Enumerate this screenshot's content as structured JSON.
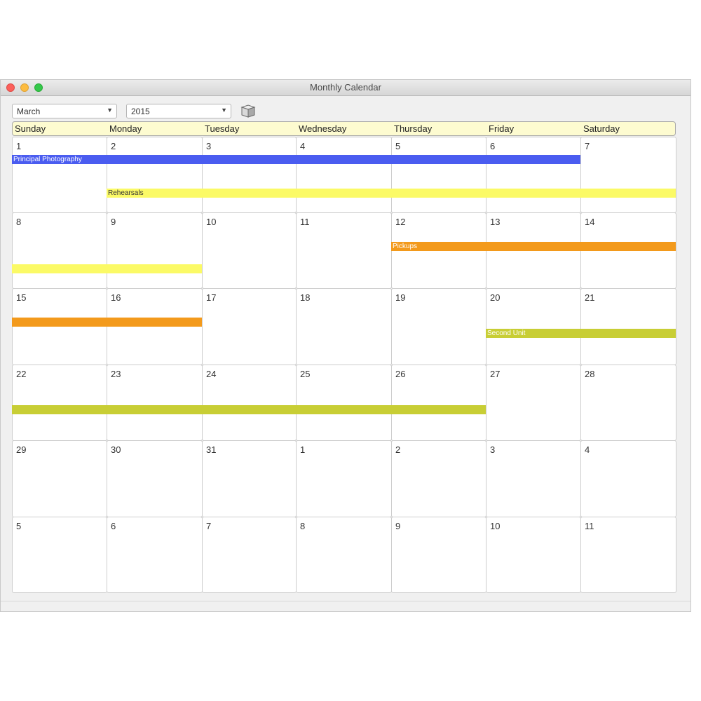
{
  "window": {
    "title": "Monthly Calendar"
  },
  "controls": {
    "month": "March",
    "year": "2015",
    "today_icon": "cube-icon"
  },
  "weekdays": [
    "Sunday",
    "Monday",
    "Tuesday",
    "Wednesday",
    "Thursday",
    "Friday",
    "Saturday"
  ],
  "weeks": [
    [
      "1",
      "2",
      "3",
      "4",
      "5",
      "6",
      "7"
    ],
    [
      "8",
      "9",
      "10",
      "11",
      "12",
      "13",
      "14"
    ],
    [
      "15",
      "16",
      "17",
      "18",
      "19",
      "20",
      "21"
    ],
    [
      "22",
      "23",
      "24",
      "25",
      "26",
      "27",
      "28"
    ],
    [
      "29",
      "30",
      "31",
      "1",
      "2",
      "3",
      "4"
    ],
    [
      "5",
      "6",
      "7",
      "8",
      "9",
      "10",
      "11"
    ]
  ],
  "events": [
    {
      "label": "Principal Photography",
      "color": "#4a5cf0",
      "text_color": "#ffffff",
      "start_date": "March 1, 2015",
      "end_date": "March 6, 2015"
    },
    {
      "label": "Rehearsals",
      "color": "#fbfa66",
      "text_color": "#333333",
      "start_date": "March 2, 2015",
      "end_date": "March 9, 2015"
    },
    {
      "label": "Pickups",
      "color": "#f39a1c",
      "text_color": "#ffffff",
      "start_date": "March 12, 2015",
      "end_date": "March 16, 2015"
    },
    {
      "label": "Second Unit",
      "color": "#c8ce35",
      "text_color": "#ffffff",
      "start_date": "March 20, 2015",
      "end_date": "March 26, 2015"
    }
  ]
}
